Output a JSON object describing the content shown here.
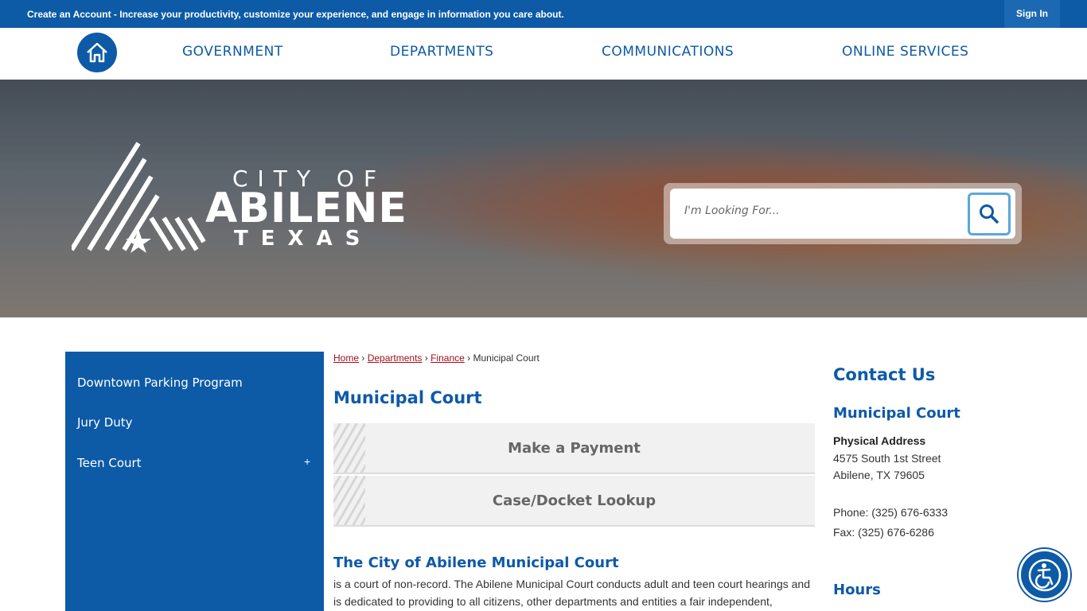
{
  "topbar": {
    "create_account_message": "Create an Account - Increase your productivity, customize your experience, and engage in information you care about.",
    "sign_in_label": "Sign In"
  },
  "nav": {
    "items": [
      {
        "label": "GOVERNMENT"
      },
      {
        "label": "DEPARTMENTS"
      },
      {
        "label": "COMMUNICATIONS"
      },
      {
        "label": "ONLINE SERVICES"
      }
    ],
    "home_icon": "home-icon"
  },
  "banner": {
    "logo_line1": "CITY OF",
    "logo_line2": "ABILENE",
    "logo_line3": "TEXAS",
    "search_placeholder": "I'm Looking For..."
  },
  "sidebar": {
    "items": [
      {
        "label": "Downtown Parking Program"
      },
      {
        "label": "Jury Duty"
      },
      {
        "label": "Teen Court",
        "expand_symbol": "+"
      }
    ]
  },
  "breadcrumb": {
    "home": "Home",
    "departments": "Departments",
    "finance": "Finance",
    "current": "Municipal Court",
    "separator": "›"
  },
  "main": {
    "title": "Municipal Court",
    "buttons": [
      {
        "label": "Make a Payment"
      },
      {
        "label": "Case/Docket Lookup"
      }
    ],
    "section_heading": "The City of Abilene Municipal Court",
    "body": "is a court of non-record. The Abilene Municipal Court conducts adult and teen court hearings and is dedicated to providing to all citizens, other departments and entities a fair independent,"
  },
  "contact": {
    "heading": "Contact Us",
    "name": "Municipal Court",
    "address_label": "Physical Address",
    "address_line1": "4575 South 1st Street",
    "address_line2": "Abilene, TX 79605",
    "phone": "Phone: (325) 676-6333",
    "fax": "Fax: (325) 676-6286",
    "hours_heading": "Hours"
  },
  "colors": {
    "primary_blue": "#0d5aa7",
    "link_red": "#a40d1a",
    "search_border": "#5aa7dc"
  }
}
